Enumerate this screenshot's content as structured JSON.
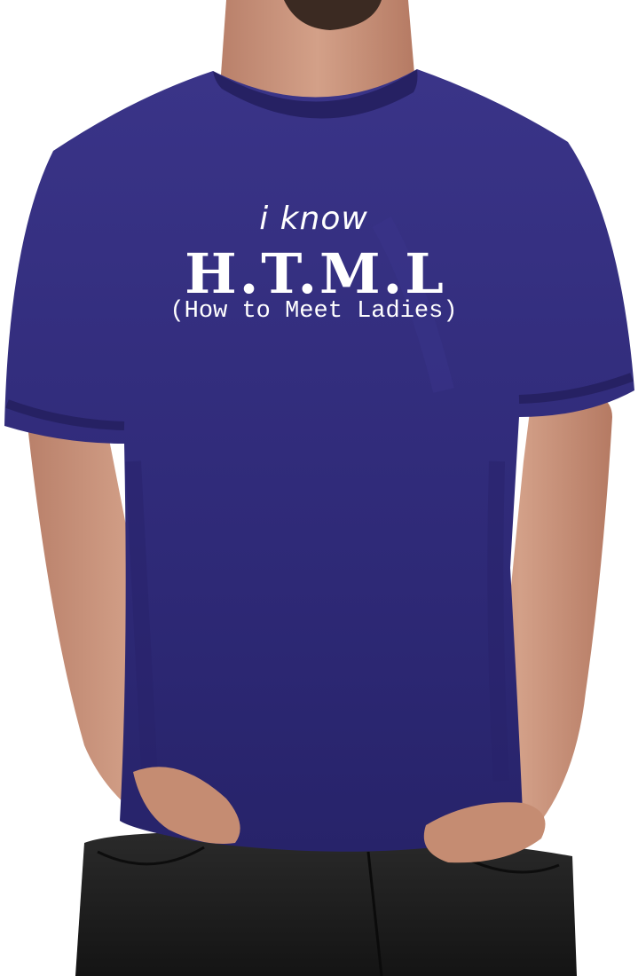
{
  "shirt": {
    "color": "#302b7a",
    "print_color": "#ffffff",
    "print": {
      "line1": "i know",
      "line2": "H.T.M.L",
      "line3": "(How to Meet Ladies)"
    }
  },
  "colors": {
    "background": "#ffffff",
    "skin": "#c89478",
    "pants": "#232323"
  }
}
